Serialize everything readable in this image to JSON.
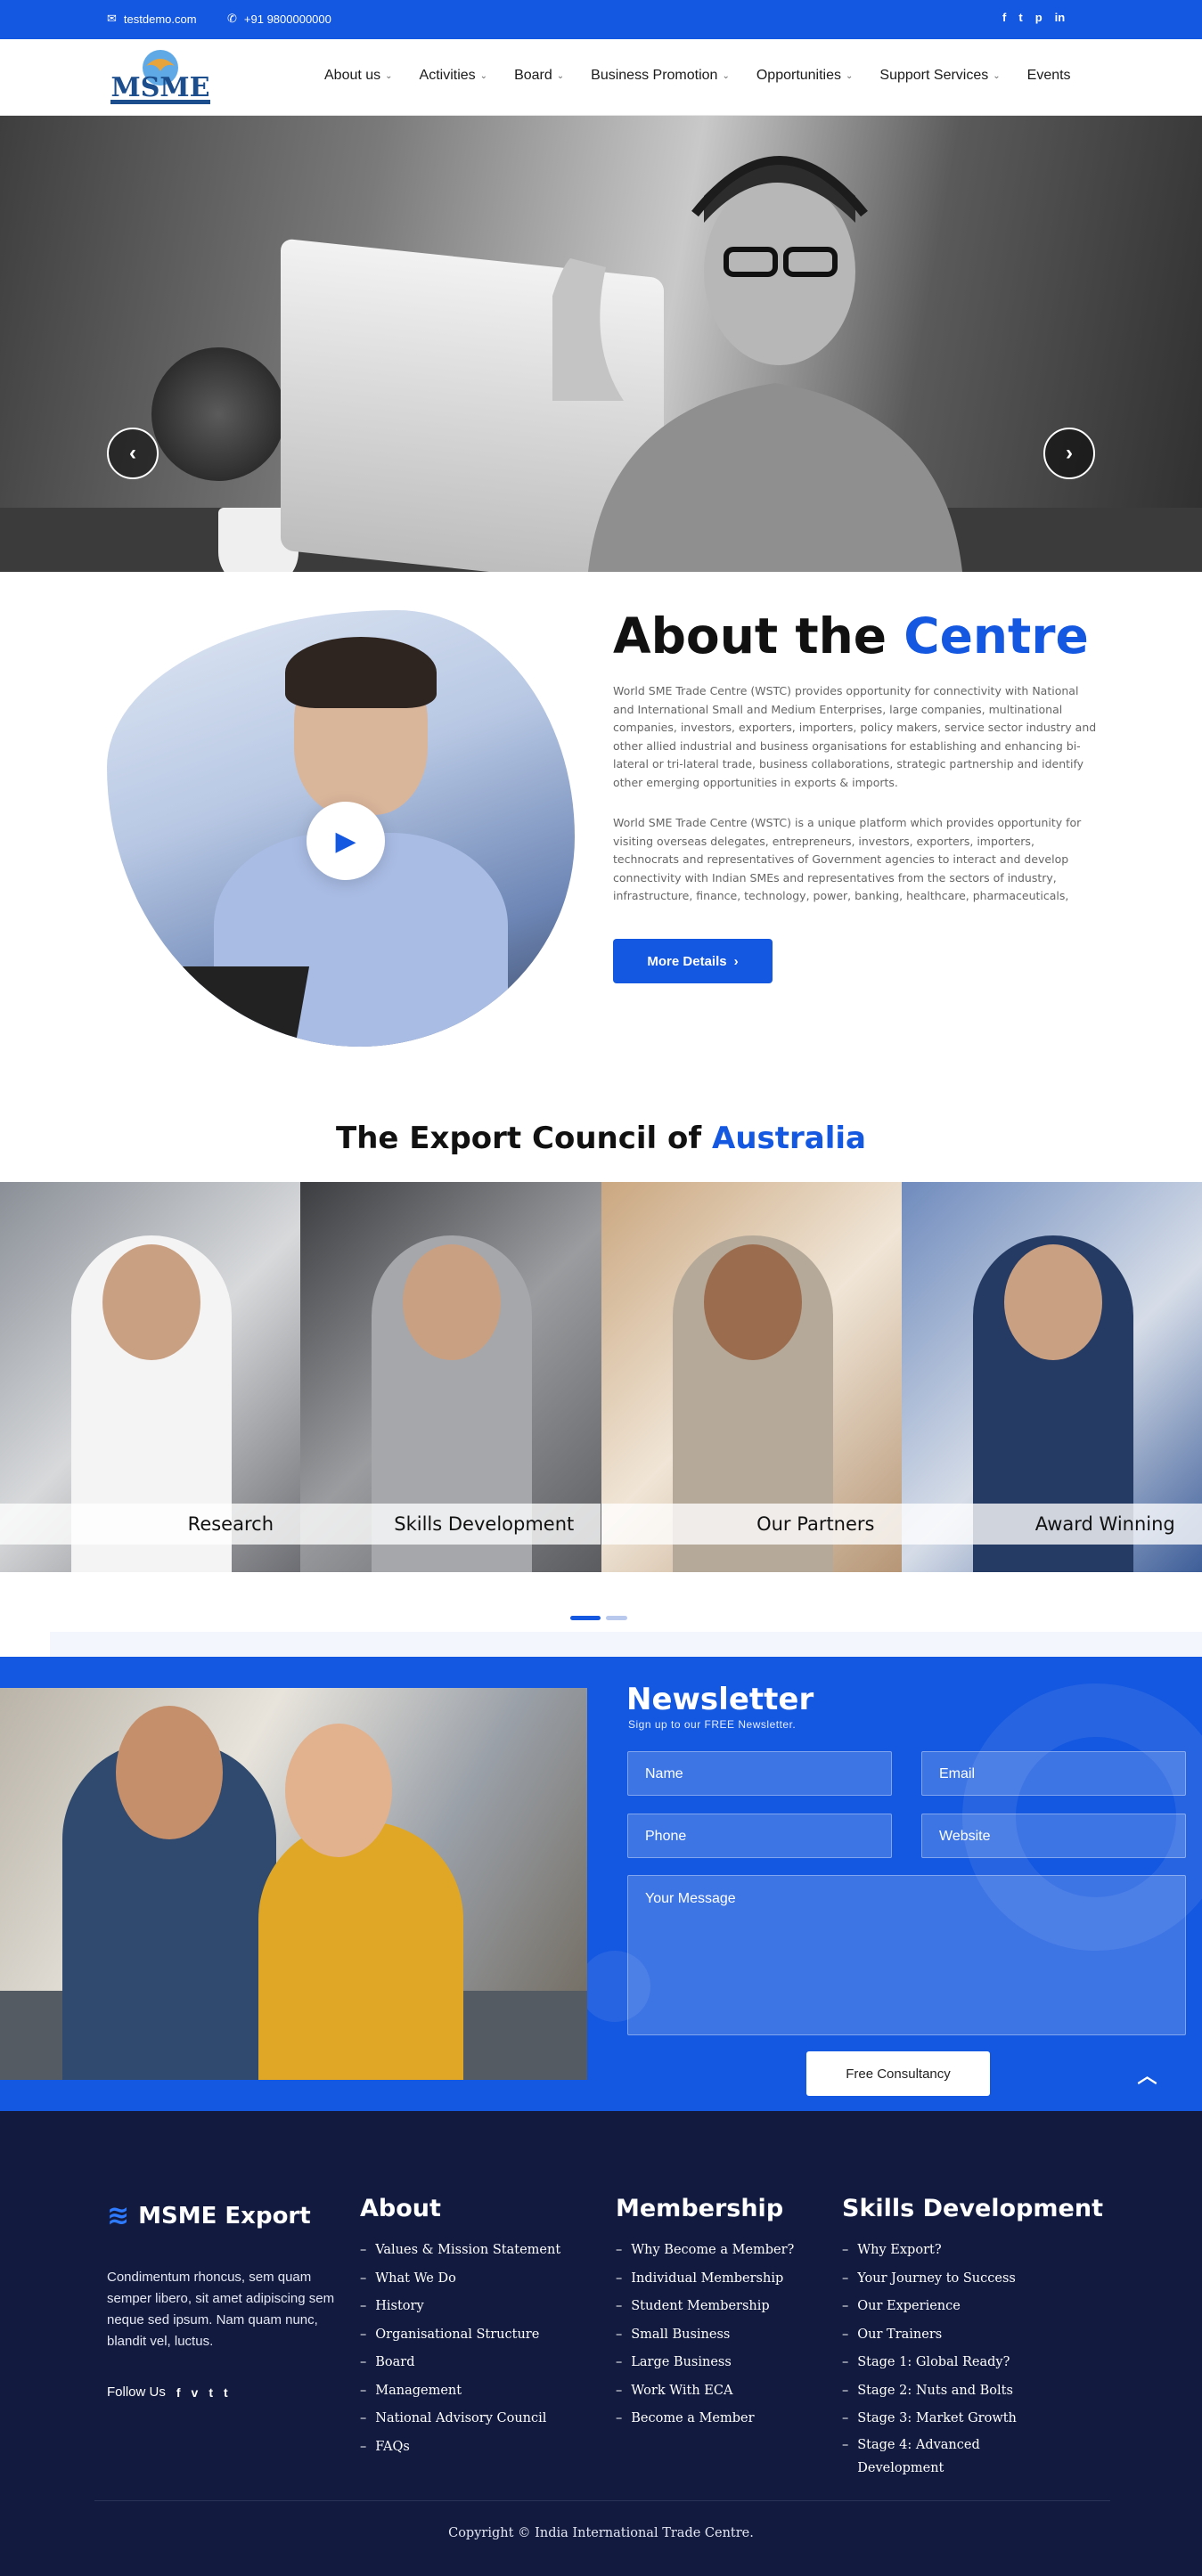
{
  "topbar": {
    "email": "testdemo.com",
    "phone": "+91 9800000000",
    "socials": [
      {
        "icon": "facebook-icon",
        "glyph": "f"
      },
      {
        "icon": "twitter-icon",
        "glyph": "t"
      },
      {
        "icon": "pinterest-icon",
        "glyph": "p"
      },
      {
        "icon": "linkedin-icon",
        "glyph": "in"
      }
    ]
  },
  "header": {
    "logo_text": "MSME",
    "nav": [
      {
        "label": "About us",
        "caret": true
      },
      {
        "label": "Activities",
        "caret": true
      },
      {
        "label": "Board",
        "caret": true
      },
      {
        "label": "Business Promotion",
        "caret": true
      },
      {
        "label": "Opportunities",
        "caret": true
      },
      {
        "label": "Support Services",
        "caret": true
      },
      {
        "label": "Events",
        "caret": false
      }
    ]
  },
  "about": {
    "title_plain": "About the ",
    "title_accent": "Centre",
    "paragraph1": "World SME Trade Centre (WSTC) provides opportunity for connectivity with National and International Small and Medium Enterprises, large companies, multinational companies, investors, exporters, importers, policy makers, service sector industry and other allied industrial and business organisations for establishing and enhancing bi-lateral or tri-lateral trade, business collaborations, strategic partnership and identify other emerging opportunities in exports & imports.",
    "paragraph2": "World SME Trade Centre (WSTC) is a unique platform which provides opportunity for visiting overseas delegates, entrepreneurs, investors, exporters, importers, technocrats and representatives of Government agencies to interact and develop connectivity with Indian SMEs and representatives from the sectors of industry, infrastructure, finance, technology, power, banking, healthcare, pharmaceuticals, packaging, food processing,",
    "button_label": "More Details"
  },
  "council": {
    "title_plain": "The Export Council of ",
    "title_accent": "Australia",
    "cards": [
      {
        "label": "Research"
      },
      {
        "label": "Skills Development"
      },
      {
        "label": "Our Partners"
      },
      {
        "label": "Award Winning"
      }
    ]
  },
  "newsletter": {
    "title": "Newsletter",
    "subtitle": "Sign up to our FREE Newsletter.",
    "name_placeholder": "Name",
    "email_placeholder": "Email",
    "phone_placeholder": "Phone",
    "website_placeholder": "Website",
    "message_placeholder": "Your Message",
    "button_label": "Free Consultancy"
  },
  "footer": {
    "brand": "MSME Export",
    "description": "Condimentum rhoncus, sem quam semper libero, sit amet adipiscing sem neque sed ipsum. Nam quam nunc, blandit vel, luctus.",
    "follow_label": "Follow Us",
    "follow_icons": [
      {
        "icon": "facebook-icon",
        "glyph": "f"
      },
      {
        "icon": "vimeo-icon",
        "glyph": "v"
      },
      {
        "icon": "twitter-icon",
        "glyph": "t"
      },
      {
        "icon": "tumblr-icon",
        "glyph": "t"
      }
    ],
    "about_title": "About",
    "about_links": [
      "Values & Mission Statement",
      "What We Do",
      "History",
      "Organisational Structure",
      "Board",
      "Management",
      "National Advisory Council",
      "FAQs"
    ],
    "membership_title": "Membership",
    "membership_links": [
      "Why Become a Member?",
      "Individual Membership",
      "Student Membership",
      "Small Business",
      "Large Business",
      "Work With ECA",
      "Become a Member"
    ],
    "skills_title": "Skills Development",
    "skills_links": [
      "Why Export?",
      "Your Journey to Success",
      "Our Experience",
      "Our Trainers",
      "Stage 1: Global Ready?",
      "Stage 2: Nuts and Bolts",
      "Stage 3: Market Growth",
      "Stage 4: Advanced Development"
    ],
    "copyright": "Copyright © India International Trade Centre."
  },
  "colors": {
    "brand_blue": "#1457e0",
    "footer_navy": "#121b3f"
  }
}
